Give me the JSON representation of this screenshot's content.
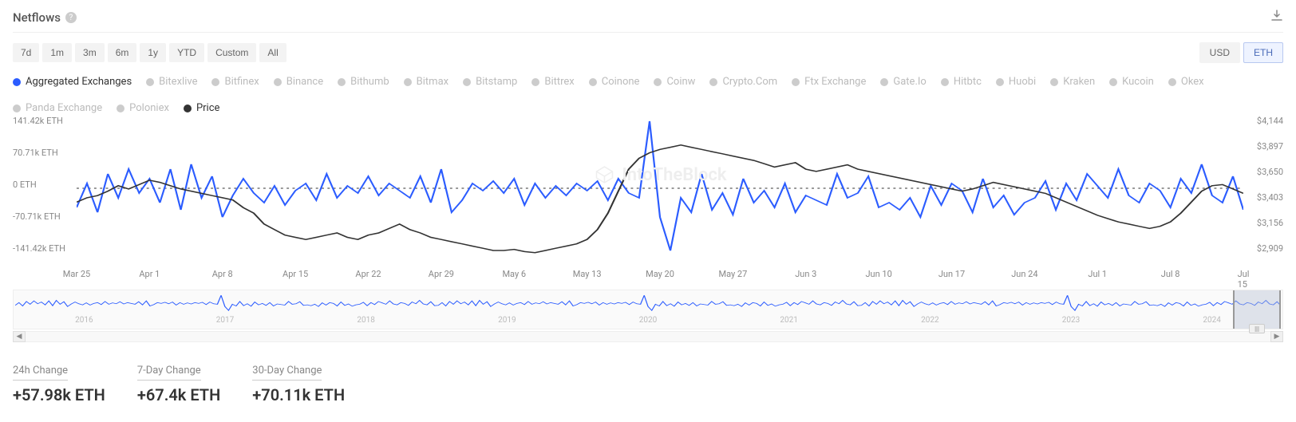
{
  "header": {
    "title": "Netflows"
  },
  "ranges": [
    "7d",
    "1m",
    "3m",
    "6m",
    "1y",
    "YTD",
    "Custom",
    "All"
  ],
  "currencies": {
    "items": [
      "USD",
      "ETH"
    ],
    "active": "ETH"
  },
  "legend": [
    {
      "label": "Aggregated Exchanges",
      "color": "#2b5cff",
      "active": true
    },
    {
      "label": "Bitexlive",
      "color": "#ccc",
      "active": false
    },
    {
      "label": "Bitfinex",
      "color": "#ccc",
      "active": false
    },
    {
      "label": "Binance",
      "color": "#ccc",
      "active": false
    },
    {
      "label": "Bithumb",
      "color": "#ccc",
      "active": false
    },
    {
      "label": "Bitmax",
      "color": "#ccc",
      "active": false
    },
    {
      "label": "Bitstamp",
      "color": "#ccc",
      "active": false
    },
    {
      "label": "Bittrex",
      "color": "#ccc",
      "active": false
    },
    {
      "label": "Coinone",
      "color": "#ccc",
      "active": false
    },
    {
      "label": "Coinw",
      "color": "#ccc",
      "active": false
    },
    {
      "label": "Crypto.Com",
      "color": "#ccc",
      "active": false
    },
    {
      "label": "Ftx Exchange",
      "color": "#ccc",
      "active": false
    },
    {
      "label": "Gate.Io",
      "color": "#ccc",
      "active": false
    },
    {
      "label": "Hitbtc",
      "color": "#ccc",
      "active": false
    },
    {
      "label": "Huobi",
      "color": "#ccc",
      "active": false
    },
    {
      "label": "Kraken",
      "color": "#ccc",
      "active": false
    },
    {
      "label": "Kucoin",
      "color": "#ccc",
      "active": false
    },
    {
      "label": "Okex",
      "color": "#ccc",
      "active": false
    },
    {
      "label": "Panda Exchange",
      "color": "#ccc",
      "active": false
    },
    {
      "label": "Poloniex",
      "color": "#ccc",
      "active": false
    },
    {
      "label": "Price",
      "color": "#333",
      "active": true
    }
  ],
  "watermark": "IntoTheBlock",
  "chart_data": {
    "type": "line",
    "x_labels": [
      "Mar 25",
      "Apr 1",
      "Apr 8",
      "Apr 15",
      "Apr 22",
      "Apr 29",
      "May 6",
      "May 13",
      "May 20",
      "May 27",
      "Jun 3",
      "Jun 10",
      "Jun 17",
      "Jun 24",
      "Jul 1",
      "Jul 8",
      "Jul 15"
    ],
    "y_left_ticks": [
      "141.42k ETH",
      "70.71k ETH",
      "0 ETH",
      "-70.71k ETH",
      "-141.42k ETH"
    ],
    "y_right_ticks": [
      "$4,144",
      "$3,897",
      "$3,650",
      "$3,403",
      "$3,156",
      "$2,909"
    ],
    "y_left_range": [
      -141420,
      141420
    ],
    "y_right_range": [
      2909,
      4144
    ],
    "series": [
      {
        "name": "Aggregated Exchanges",
        "axis": "left",
        "color": "#2b5cff",
        "values": [
          -40000,
          10000,
          -50000,
          30000,
          -20000,
          40000,
          -10000,
          20000,
          -30000,
          40000,
          -45000,
          50000,
          -20000,
          25000,
          -60000,
          -15000,
          20000,
          -10000,
          -30000,
          5000,
          -35000,
          -5000,
          10000,
          -25000,
          30000,
          -20000,
          5000,
          -10000,
          25000,
          -15000,
          10000,
          -5000,
          -20000,
          25000,
          -30000,
          40000,
          -50000,
          -25000,
          10000,
          -5000,
          15000,
          -10000,
          20000,
          -35000,
          10000,
          -20000,
          5000,
          -15000,
          10000,
          -5000,
          15000,
          -25000,
          20000,
          -10000,
          -20000,
          140000,
          -60000,
          -130000,
          -20000,
          -50000,
          30000,
          -45000,
          -10000,
          -55000,
          20000,
          -30000,
          -5000,
          -40000,
          10000,
          -50000,
          -15000,
          -25000,
          -35000,
          30000,
          -20000,
          -10000,
          25000,
          -40000,
          -30000,
          -45000,
          -20000,
          -60000,
          5000,
          -35000,
          10000,
          -5000,
          -50000,
          20000,
          -40000,
          -15000,
          -55000,
          -30000,
          -20000,
          15000,
          -45000,
          10000,
          -25000,
          30000,
          5000,
          -20000,
          40000,
          -15000,
          -30000,
          10000,
          -5000,
          -40000,
          20000,
          -10000,
          50000,
          -15000,
          -30000,
          25000,
          -45000
        ]
      },
      {
        "name": "Price",
        "axis": "right",
        "color": "#333",
        "values": [
          3400,
          3440,
          3460,
          3500,
          3550,
          3520,
          3560,
          3600,
          3580,
          3550,
          3520,
          3500,
          3480,
          3460,
          3440,
          3420,
          3350,
          3300,
          3200,
          3150,
          3100,
          3080,
          3060,
          3080,
          3100,
          3120,
          3080,
          3060,
          3100,
          3120,
          3160,
          3200,
          3150,
          3120,
          3080,
          3060,
          3040,
          3020,
          3000,
          2980,
          2960,
          2960,
          2970,
          2950,
          2940,
          2960,
          2980,
          3000,
          3020,
          3060,
          3150,
          3300,
          3500,
          3700,
          3800,
          3850,
          3880,
          3900,
          3920,
          3900,
          3880,
          3860,
          3840,
          3820,
          3800,
          3780,
          3750,
          3720,
          3740,
          3760,
          3700,
          3680,
          3700,
          3720,
          3740,
          3700,
          3680,
          3660,
          3640,
          3620,
          3600,
          3580,
          3560,
          3540,
          3520,
          3500,
          3520,
          3550,
          3580,
          3560,
          3540,
          3520,
          3500,
          3480,
          3440,
          3400,
          3360,
          3320,
          3280,
          3250,
          3220,
          3200,
          3180,
          3160,
          3180,
          3220,
          3300,
          3400,
          3500,
          3550,
          3560,
          3520,
          3480
        ]
      }
    ]
  },
  "navigator": {
    "ticks": [
      "2016",
      "2017",
      "2018",
      "2019",
      "2020",
      "2021",
      "2022",
      "2023",
      "2024"
    ]
  },
  "stats": [
    {
      "label": "24h Change",
      "value": "+57.98k ETH"
    },
    {
      "label": "7-Day Change",
      "value": "+67.4k ETH"
    },
    {
      "label": "30-Day Change",
      "value": "+70.11k ETH"
    }
  ]
}
